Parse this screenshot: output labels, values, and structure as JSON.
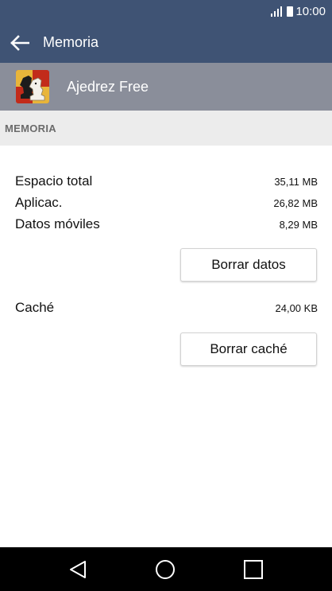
{
  "status_bar": {
    "time": "10:00",
    "icons": [
      "signal-icon",
      "battery-icon"
    ]
  },
  "app_bar": {
    "back_icon": "arrow-left-icon",
    "title": "Memoria"
  },
  "app_header": {
    "app_icon": "chess-knight-app-icon",
    "app_name": "Ajedrez Free"
  },
  "section": {
    "title": "MEMORIA"
  },
  "storage": {
    "rows": [
      {
        "label": "Espacio total",
        "value": "35,11 MB"
      },
      {
        "label": "Aplicac.",
        "value": "26,82 MB"
      },
      {
        "label": "Datos móviles",
        "value": "8,29 MB"
      }
    ],
    "clear_data_button": "Borrar datos"
  },
  "cache": {
    "label": "Caché",
    "value": "24,00 KB",
    "clear_cache_button": "Borrar caché"
  },
  "nav_bar": {
    "icons": [
      "back-triangle-icon",
      "home-circle-icon",
      "recents-square-icon"
    ]
  },
  "colors": {
    "primary": "#3f5374",
    "app_header_bg": "#8a8e9a",
    "section_bg": "#ececec",
    "nav_bg": "#000000"
  }
}
